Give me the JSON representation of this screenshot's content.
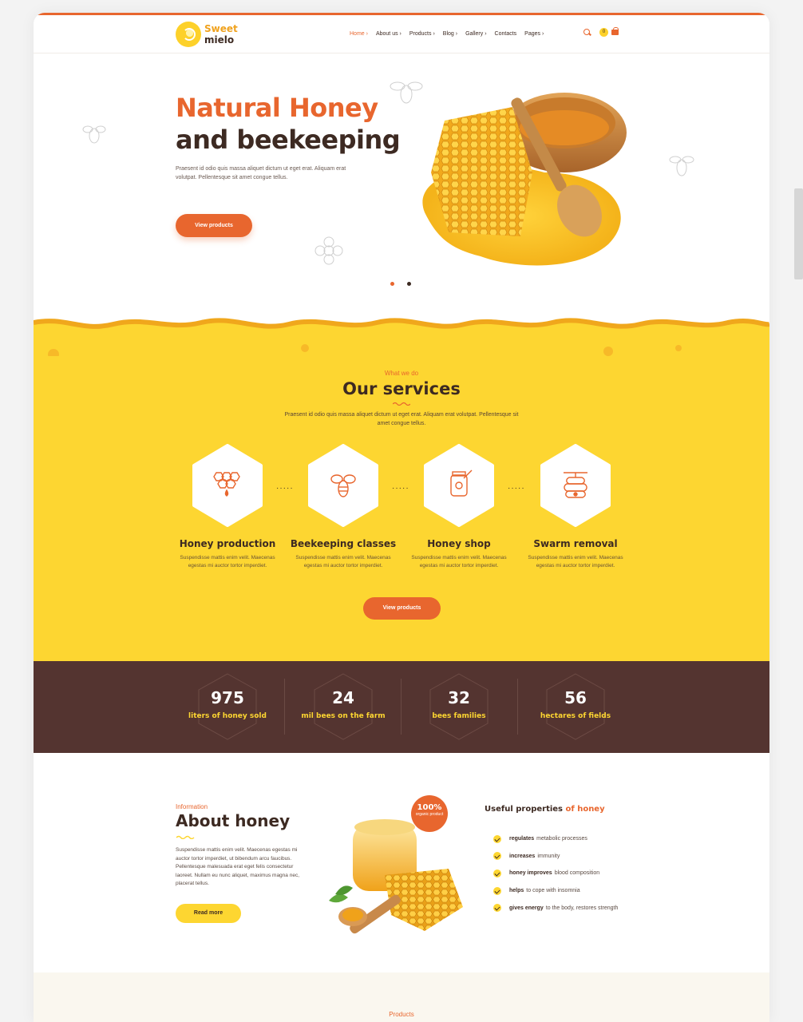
{
  "header": {
    "logo_line1": "Sweet",
    "logo_line2": "mielo",
    "nav": [
      "Home ›",
      "About us ›",
      "Products ›",
      "Blog ›",
      "Gallery ›",
      "Contacts",
      "Pages ›"
    ],
    "cart_count": "0"
  },
  "hero": {
    "title_line1": "Natural Honey",
    "title_line2": "and beekeeping",
    "text": "Praesent id odio quis massa aliquet dictum ut eget erat. Aliquam erat volutpat. Pellentesque sit amet congue tellus.",
    "button": "View products",
    "slides": 2,
    "active_slide": 1
  },
  "services": {
    "eyebrow": "What we do",
    "title": "Our services",
    "text": "Praesent id odio quis massa aliquet dictum ut eget erat. Aliquam erat volutpat. Pellentesque sit amet congue tellus.",
    "items": [
      {
        "title": "Honey production",
        "text": "Suspendisse mattis enim velit. Maecenas egestas mi auctor tortor imperdiet.",
        "icon": "honeycomb-icon"
      },
      {
        "title": "Beekeeping classes",
        "text": "Suspendisse mattis enim velit. Maecenas egestas mi auctor tortor imperdiet.",
        "icon": "bee-icon"
      },
      {
        "title": "Honey shop",
        "text": "Suspendisse mattis enim velit. Maecenas egestas mi auctor tortor imperdiet.",
        "icon": "honey-jar-icon"
      },
      {
        "title": "Swarm removal",
        "text": "Suspendisse mattis enim velit. Maecenas egestas mi auctor tortor imperdiet.",
        "icon": "beehive-icon"
      }
    ],
    "button": "View products"
  },
  "stats": [
    {
      "value": "975",
      "label": "liters of honey sold"
    },
    {
      "value": "24",
      "label": "mil bees on the farm"
    },
    {
      "value": "32",
      "label": "bees families"
    },
    {
      "value": "56",
      "label": "hectares of fields"
    }
  ],
  "about": {
    "eyebrow": "Information",
    "title": "About honey",
    "text": "Suspendisse mattis enim velit. Maecenas egestas mi auctor tortor imperdiet, ut bibendum arcu faucibus. Pellentesque malesuada erat eget felis consectetur laoreet. Nullam eu nunc aliquet, maximus magna nec, placerat tellus.",
    "button": "Read more",
    "badge_percent": "100%",
    "badge_text": "organic product"
  },
  "properties": {
    "title_plain": "Useful properties",
    "title_highlight": "of honey",
    "items": [
      {
        "bold": "regulates",
        "rest": "metabolic processes"
      },
      {
        "bold": "increases",
        "rest": "immunity"
      },
      {
        "bold": "honey improves",
        "rest": "blood composition"
      },
      {
        "bold": "helps",
        "rest": "to cope with insomnia"
      },
      {
        "bold": "gives energy",
        "rest": "to the body, restores strength"
      }
    ]
  },
  "footer_label": "Products",
  "colors": {
    "accent": "#e8662e",
    "yellow": "#fdd631",
    "brown": "#543430",
    "text": "#3d2a22"
  }
}
